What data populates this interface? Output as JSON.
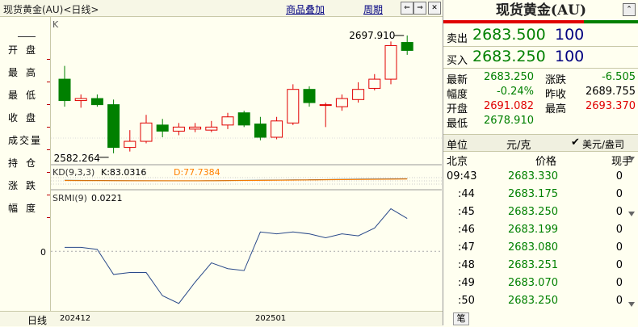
{
  "window": {
    "title": "现货黄金(AU)<日线>",
    "overlay_button": "商品叠加",
    "period_button": "周期"
  },
  "left_panel": {
    "items": [
      "开盘",
      "最高",
      "最低",
      "收盘",
      "成交量",
      "持仓",
      "涨跌",
      "幅度"
    ]
  },
  "chart": {
    "k_label": "K",
    "high_annotation": "2697.910",
    "low_annotation": "2582.264",
    "kd_label": "KD(9,3,3)",
    "kd_k": "K:83.0316",
    "kd_d": "D:77.7384",
    "srmi_label": "SRMI(9)",
    "srmi_value": "0.0221",
    "srmi_zero": "0",
    "x_labels": [
      "202412",
      "202501"
    ],
    "colors": {
      "up": "#e00000",
      "down": "#008000",
      "kd_d": "#ff8000",
      "line": "#2a4a8a"
    }
  },
  "chart_data": {
    "type": "candlestick",
    "candles": [
      {
        "o": 2655,
        "h": 2668,
        "l": 2628,
        "c": 2634
      },
      {
        "o": 2634,
        "h": 2640,
        "l": 2627,
        "c": 2636
      },
      {
        "o": 2636,
        "h": 2640,
        "l": 2628,
        "c": 2630
      },
      {
        "o": 2630,
        "h": 2635,
        "l": 2582.264,
        "c": 2588
      },
      {
        "o": 2588,
        "h": 2605,
        "l": 2584,
        "c": 2594
      },
      {
        "o": 2594,
        "h": 2620,
        "l": 2592,
        "c": 2612
      },
      {
        "o": 2610,
        "h": 2616,
        "l": 2598,
        "c": 2604
      },
      {
        "o": 2604,
        "h": 2612,
        "l": 2600,
        "c": 2608
      },
      {
        "o": 2606,
        "h": 2612,
        "l": 2603,
        "c": 2608
      },
      {
        "o": 2605,
        "h": 2614,
        "l": 2603,
        "c": 2608
      },
      {
        "o": 2610,
        "h": 2622,
        "l": 2606,
        "c": 2618
      },
      {
        "o": 2622,
        "h": 2624,
        "l": 2608,
        "c": 2610
      },
      {
        "o": 2611,
        "h": 2618,
        "l": 2595,
        "c": 2598
      },
      {
        "o": 2598,
        "h": 2618,
        "l": 2596,
        "c": 2614
      },
      {
        "o": 2612,
        "h": 2650,
        "l": 2610,
        "c": 2645
      },
      {
        "o": 2645,
        "h": 2648,
        "l": 2628,
        "c": 2632
      },
      {
        "o": 2630,
        "h": 2632,
        "l": 2608,
        "c": 2630
      },
      {
        "o": 2628,
        "h": 2640,
        "l": 2624,
        "c": 2636
      },
      {
        "o": 2635,
        "h": 2652,
        "l": 2632,
        "c": 2645
      },
      {
        "o": 2646,
        "h": 2660,
        "l": 2644,
        "c": 2655
      },
      {
        "o": 2655,
        "h": 2692,
        "l": 2650,
        "c": 2688
      },
      {
        "o": 2691.082,
        "h": 2697.91,
        "l": 2678.91,
        "c": 2683.25
      }
    ],
    "kd_k": 83.0316,
    "kd_d": 77.7384,
    "srmi": [
      {
        "x": "1",
        "y": 0.02
      },
      {
        "x": "2",
        "y": 0.02
      },
      {
        "x": "3",
        "y": 0.01
      },
      {
        "x": "4",
        "y": -0.12
      },
      {
        "x": "5",
        "y": -0.11
      },
      {
        "x": "6",
        "y": -0.11
      },
      {
        "x": "7",
        "y": -0.23
      },
      {
        "x": "8",
        "y": -0.27
      },
      {
        "x": "9",
        "y": -0.16
      },
      {
        "x": "10",
        "y": -0.06
      },
      {
        "x": "11",
        "y": -0.09
      },
      {
        "x": "12",
        "y": -0.1
      },
      {
        "x": "13",
        "y": 0.1
      },
      {
        "x": "14",
        "y": 0.09
      },
      {
        "x": "15",
        "y": 0.1
      },
      {
        "x": "16",
        "y": 0.09
      },
      {
        "x": "17",
        "y": 0.07
      },
      {
        "x": "18",
        "y": 0.09
      },
      {
        "x": "19",
        "y": 0.08
      },
      {
        "x": "20",
        "y": 0.12
      },
      {
        "x": "21",
        "y": 0.22
      },
      {
        "x": "22",
        "y": 0.17
      }
    ],
    "ylim": [
      2575,
      2705
    ],
    "srmi_ylim": [
      -0.3,
      0.26
    ]
  },
  "quote": {
    "title": "现货黄金(AU)",
    "sell_label": "卖出",
    "sell_price": "2683.500",
    "sell_vol": "100",
    "buy_label": "买入",
    "buy_price": "2683.250",
    "buy_vol": "100",
    "stats": [
      {
        "l1": "最新",
        "v1": "2683.250",
        "c1": "#008000",
        "l2": "涨跌",
        "v2": "-6.505",
        "c2": "#008000"
      },
      {
        "l1": "幅度",
        "v1": "-0.24%",
        "c1": "#008000",
        "l2": "昨收",
        "v2": "2689.755",
        "c2": "#000000"
      },
      {
        "l1": "开盘",
        "v1": "2691.082",
        "c1": "#e00000",
        "l2": "最高",
        "v2": "2693.370",
        "c2": "#e00000"
      },
      {
        "l1": "最低",
        "v1": "2678.910",
        "c1": "#008000",
        "l2": "",
        "v2": "",
        "c2": "#000000"
      }
    ],
    "unit_label": "单位",
    "unit_value": "元/克",
    "unit_option": "美元/盎司",
    "ticks_header": {
      "time": "北京",
      "price": "价格",
      "vol": "现手"
    },
    "ticks": [
      {
        "t": "09:43",
        "p": "2683.330",
        "v": "0"
      },
      {
        "t": ":44",
        "p": "2683.175",
        "v": "0"
      },
      {
        "t": ":45",
        "p": "2683.250",
        "v": "0"
      },
      {
        "t": ":46",
        "p": "2683.199",
        "v": "0"
      },
      {
        "t": ":47",
        "p": "2683.080",
        "v": "0"
      },
      {
        "t": ":48",
        "p": "2683.251",
        "v": "0"
      },
      {
        "t": ":49",
        "p": "2683.070",
        "v": "0"
      },
      {
        "t": ":50",
        "p": "2683.250",
        "v": "0"
      }
    ],
    "tab_label": "笔"
  },
  "bottom": {
    "period_label": "日线"
  }
}
